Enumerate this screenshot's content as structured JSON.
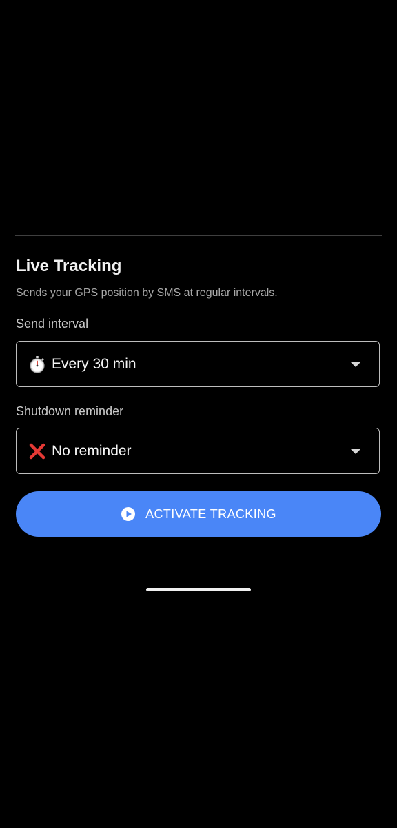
{
  "section": {
    "title": "Live Tracking",
    "description": "Sends your GPS position by SMS at regular intervals."
  },
  "send_interval": {
    "label": "Send interval",
    "selected_value": "Every 30 min",
    "icon": "stopwatch-emoji-icon"
  },
  "shutdown_reminder": {
    "label": "Shutdown reminder",
    "selected_value": "No reminder",
    "icon": "cross-mark-emoji-icon"
  },
  "activate_button": {
    "label": "ACTIVATE TRACKING",
    "icon": "play-circle-icon"
  },
  "colors": {
    "background": "#000000",
    "accent": "#4a86f7",
    "text_primary": "#f2f2f2",
    "text_secondary": "#a8a8a8",
    "border": "#bdbdbd",
    "cross_red": "#e53935"
  }
}
